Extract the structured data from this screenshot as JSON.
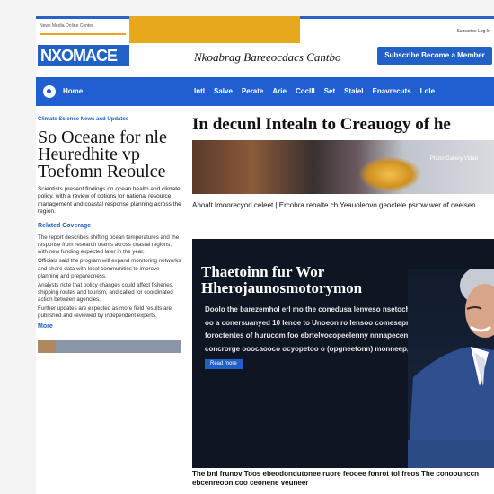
{
  "header": {
    "tiny_nav": "News Media Online Center",
    "utility_link": "Subscribe  Log In",
    "logo": "NXOMACE",
    "site_subtitle": "Nkoabrag Bareeocdacs Cantbo",
    "cta": "Subscribe  Become a Member"
  },
  "nav": {
    "brand": "Home",
    "items": [
      "Intl",
      "Salve",
      "Perate",
      "Arie",
      "Coclll",
      "Set",
      "Stalel",
      "Enavrecuts",
      "Lole"
    ]
  },
  "left": {
    "kicker": "Climate Science News and Updates",
    "headline": "So Oceane for nle Heuredhite vp Toefomn Reoulce",
    "deck": "Scientists present findings on ocean health and climate policy, with a review of options for national resource management and coastal response planning across the region.",
    "section_label": "Related Coverage",
    "paragraphs": [
      "The report describes shifting ocean temperatures and the response from research teams across coastal regions, with new funding expected later in the year.",
      "Officials said the program will expand monitoring networks and share data with local communities to improve planning and preparedness.",
      "Analysts note that policy changes could affect fisheries, shipping routes and tourism, and called for coordinated action between agencies.",
      "Further updates are expected as more field results are published and reviewed by independent experts."
    ],
    "more_label": "More"
  },
  "feature": {
    "title": "In decunl Intealn to Creauogy of he",
    "image_overlay": "Photo  Gallery  Video",
    "caption": "Aboalt Imoorecyod celeet | Ercohra reoalte ch Yeauolenvo geoctele psrow wer of ceelsen"
  },
  "hero": {
    "title_line1": "Thaetoinn fur Wor",
    "title_line2": "Hherojaunosmotorymon",
    "body": "Doolo the barezemhol erl mo the conedusa lenveso nsetoche rethovorea oo a conersuanyed 10 lenoe to Unoeon ro lensoo comeseprnoiccm unpoe foroctentes of hurucom foo ebrtelvocopeelenny nnnapecenncoo bnoor concrorge ooocaooco ocyopetoo o (opgneetonn) monneep, pem",
    "button": "Read more"
  },
  "bottom_text": "The bnl frunov Toos ebeodondutonee ruore feooee fonrot tol freos The conoounccn ebcenreoon coo ceonene veuneer"
}
